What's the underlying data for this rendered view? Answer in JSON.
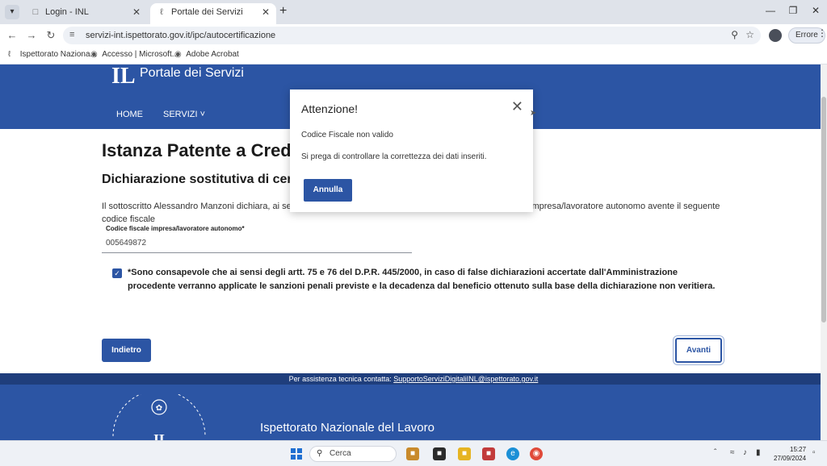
{
  "browser": {
    "tabs": [
      {
        "title": "Login - INL"
      },
      {
        "title": "Portale dei Servizi"
      }
    ],
    "url": "servizi-int.ispettorato.gov.it/ipc/autocertificazione",
    "profile_error_label": "Errore",
    "bookmarks": [
      {
        "label": "Ispettorato Naziona..."
      },
      {
        "label": "Accesso | Microsoft..."
      },
      {
        "label": "Adobe Acrobat"
      }
    ]
  },
  "site": {
    "portal_title": "Portale dei Servizi",
    "nav": [
      {
        "label": "HOME"
      },
      {
        "label": "SERVIZI ˅"
      }
    ]
  },
  "content": {
    "title": "Istanza Patente a Crediti",
    "subtitle": "Dichiarazione sostitutiva di certificazione",
    "intro_left": "Il sottoscritto Alessandro Manzoni dichiara, ai sensi",
    "intro_right": "impresa/lavoratore autonomo avente il seguente",
    "intro_line2": "codice fiscale",
    "field_label": "Codice fiscale impresa/lavoratore autonomo*",
    "field_value": "005649872",
    "declaration": "*Sono consapevole che ai sensi degli artt. 75 e 76 del D.P.R. 445/2000, in caso di false dichiarazioni accertate dall'Amministrazione procedente verranno applicate le sanzioni penali previste e la decadenza dal beneficio ottenuto sulla base della dichiarazione non veritiera.",
    "back_label": "Indietro",
    "next_label": "Avanti"
  },
  "support": {
    "prefix": "Per assistenza tecnica contatta: ",
    "email": "SupportoServiziDigitaliINL@ispettorato.gov.it"
  },
  "footer": {
    "title": "Ispettorato Nazionale del Lavoro"
  },
  "modal": {
    "title": "Attenzione!",
    "message1": "Codice Fiscale non valido",
    "message2": "Si prega di controllare la correttezza dei dati inseriti.",
    "button_label": "Annulla"
  },
  "taskbar": {
    "search_label": "Cerca",
    "time": "15:27",
    "date": "27/09/2024"
  },
  "colors": {
    "brand_blue": "#2c55a4",
    "support_bar": "#1f3e7c"
  }
}
